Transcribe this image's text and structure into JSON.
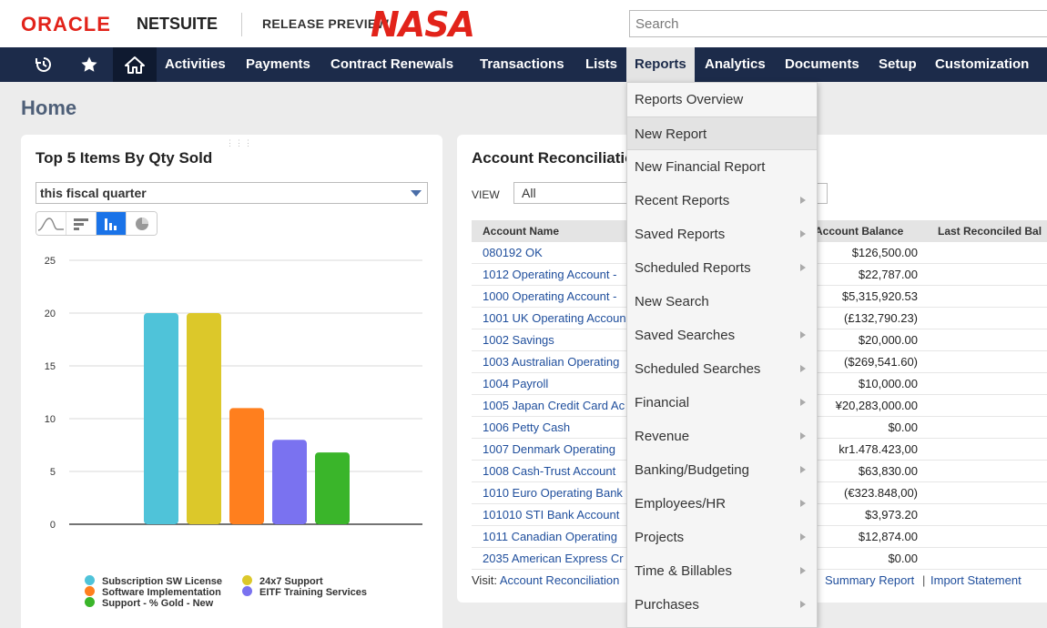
{
  "header": {
    "brand_oracle": "ORACLE",
    "brand_netsuite": "NETSUITE",
    "release": "RELEASE PREVIEW",
    "nasa": "NASA",
    "search_placeholder": "Search"
  },
  "nav": {
    "items": [
      "Activities",
      "Payments",
      "Contract Renewals",
      "Transactions",
      "Lists",
      "Reports",
      "Analytics",
      "Documents",
      "Setup",
      "Customization"
    ],
    "active": "Reports"
  },
  "page_title": "Home",
  "top_items": {
    "title": "Top 5 Items By Qty Sold",
    "period": "this fiscal quarter",
    "chart_types": [
      "line-chart-icon",
      "horizontal-bar-icon",
      "bar-chart-icon",
      "pie-chart-icon"
    ]
  },
  "chart_data": {
    "type": "bar",
    "categories": [
      "Subscription SW License",
      "24x7 Support",
      "Software Implementation",
      "EITF Training Services",
      "Support - % Gold - New"
    ],
    "values": [
      20,
      20,
      11,
      8,
      6.8
    ],
    "colors": [
      "#4fc3d9",
      "#dcc82a",
      "#ff7f1e",
      "#7a72f0",
      "#3ab52a"
    ],
    "ylim": [
      0,
      25
    ],
    "yticks": [
      0,
      5,
      10,
      15,
      20,
      25
    ],
    "legend_placement": "bottom",
    "grid": true
  },
  "account_rec": {
    "title": "Account Reconciliation",
    "view_label": "VIEW",
    "view_value": "All",
    "columns": [
      "Account Name",
      "Account Balance",
      "Last Reconciled Bal"
    ],
    "rows": [
      {
        "name": "080192 OK",
        "balance": "$126,500.00"
      },
      {
        "name": "1012 Operating Account -",
        "balance": "$22,787.00"
      },
      {
        "name": "1000 Operating Account -",
        "balance": "$5,315,920.53"
      },
      {
        "name": "1001 UK Operating Accoun",
        "balance": "(£132,790.23)"
      },
      {
        "name": "1002 Savings",
        "balance": "$20,000.00"
      },
      {
        "name": "1003 Australian Operating",
        "balance": "($269,541.60)"
      },
      {
        "name": "1004 Payroll",
        "balance": "$10,000.00"
      },
      {
        "name": "1005 Japan Credit Card Ac",
        "balance": "¥20,283,000.00"
      },
      {
        "name": "1006 Petty Cash",
        "balance": "$0.00"
      },
      {
        "name": "1007 Denmark Operating",
        "balance": "kr1.478.423,00"
      },
      {
        "name": "1008 Cash-Trust Account",
        "balance": "$63,830.00"
      },
      {
        "name": "1010 Euro Operating Bank",
        "balance": "(€323.848,00)"
      },
      {
        "name": "101010 STI Bank Account",
        "balance": "$3,973.20"
      },
      {
        "name": "1011 Canadian Operating",
        "balance": "$12,874.00"
      },
      {
        "name": "2035 American Express Cr",
        "balance": "$0.00"
      }
    ],
    "visit_label": "Visit:",
    "visit_link": "Account Reconciliation",
    "summary_link": "Summary Report",
    "import_link": "Import Statement"
  },
  "reports_menu": {
    "items": [
      {
        "label": "Reports Overview",
        "submenu": false
      },
      {
        "label": "New Report",
        "submenu": false,
        "hover": true
      },
      {
        "label": "New Financial Report",
        "submenu": false
      },
      {
        "label": "Recent Reports",
        "submenu": true
      },
      {
        "label": "Saved Reports",
        "submenu": true
      },
      {
        "label": "Scheduled Reports",
        "submenu": true
      },
      {
        "label": "New Search",
        "submenu": false
      },
      {
        "label": "Saved Searches",
        "submenu": true
      },
      {
        "label": "Scheduled Searches",
        "submenu": true
      },
      {
        "label": "Financial",
        "submenu": true
      },
      {
        "label": "Revenue",
        "submenu": true
      },
      {
        "label": "Banking/Budgeting",
        "submenu": true
      },
      {
        "label": "Employees/HR",
        "submenu": true
      },
      {
        "label": "Projects",
        "submenu": true
      },
      {
        "label": "Time & Billables",
        "submenu": true
      },
      {
        "label": "Purchases",
        "submenu": true
      }
    ]
  }
}
